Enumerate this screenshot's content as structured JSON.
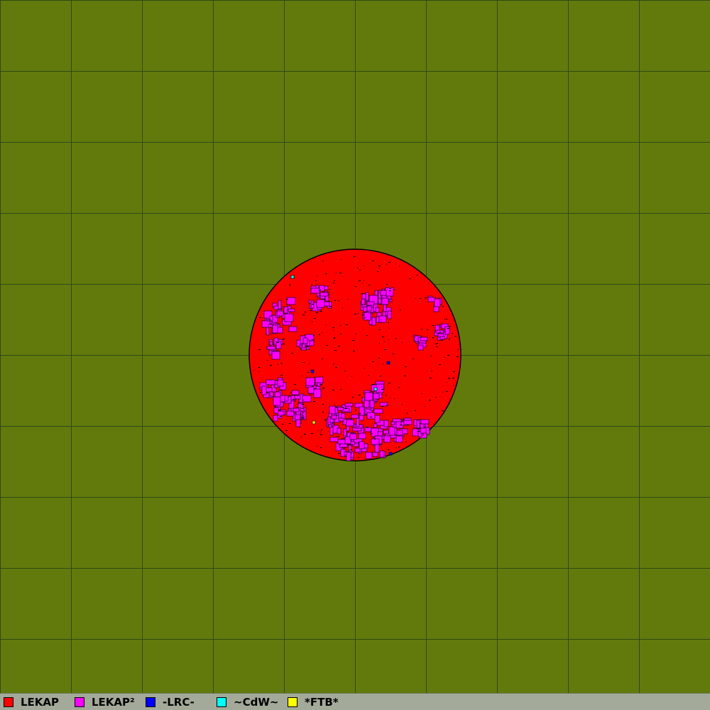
{
  "map": {
    "background_color": "#627a0c",
    "grid_line_color": "#2f4a16",
    "grid_divisions": 10,
    "territory_outline_color": "#000000"
  },
  "territory": {
    "owner": "LEKAP",
    "color": "#ff0000",
    "shape": "circle"
  },
  "legend": {
    "items": [
      {
        "label": "LEKAP",
        "color": "#ff0000"
      },
      {
        "label": "LEKAP²",
        "color": "#ff00ff"
      },
      {
        "label": "-LRC-",
        "color": "#0000ff"
      },
      {
        "label": "~CdW~",
        "color": "#00ffff"
      },
      {
        "label": "*FTB*",
        "color": "#ffff00"
      }
    ]
  }
}
